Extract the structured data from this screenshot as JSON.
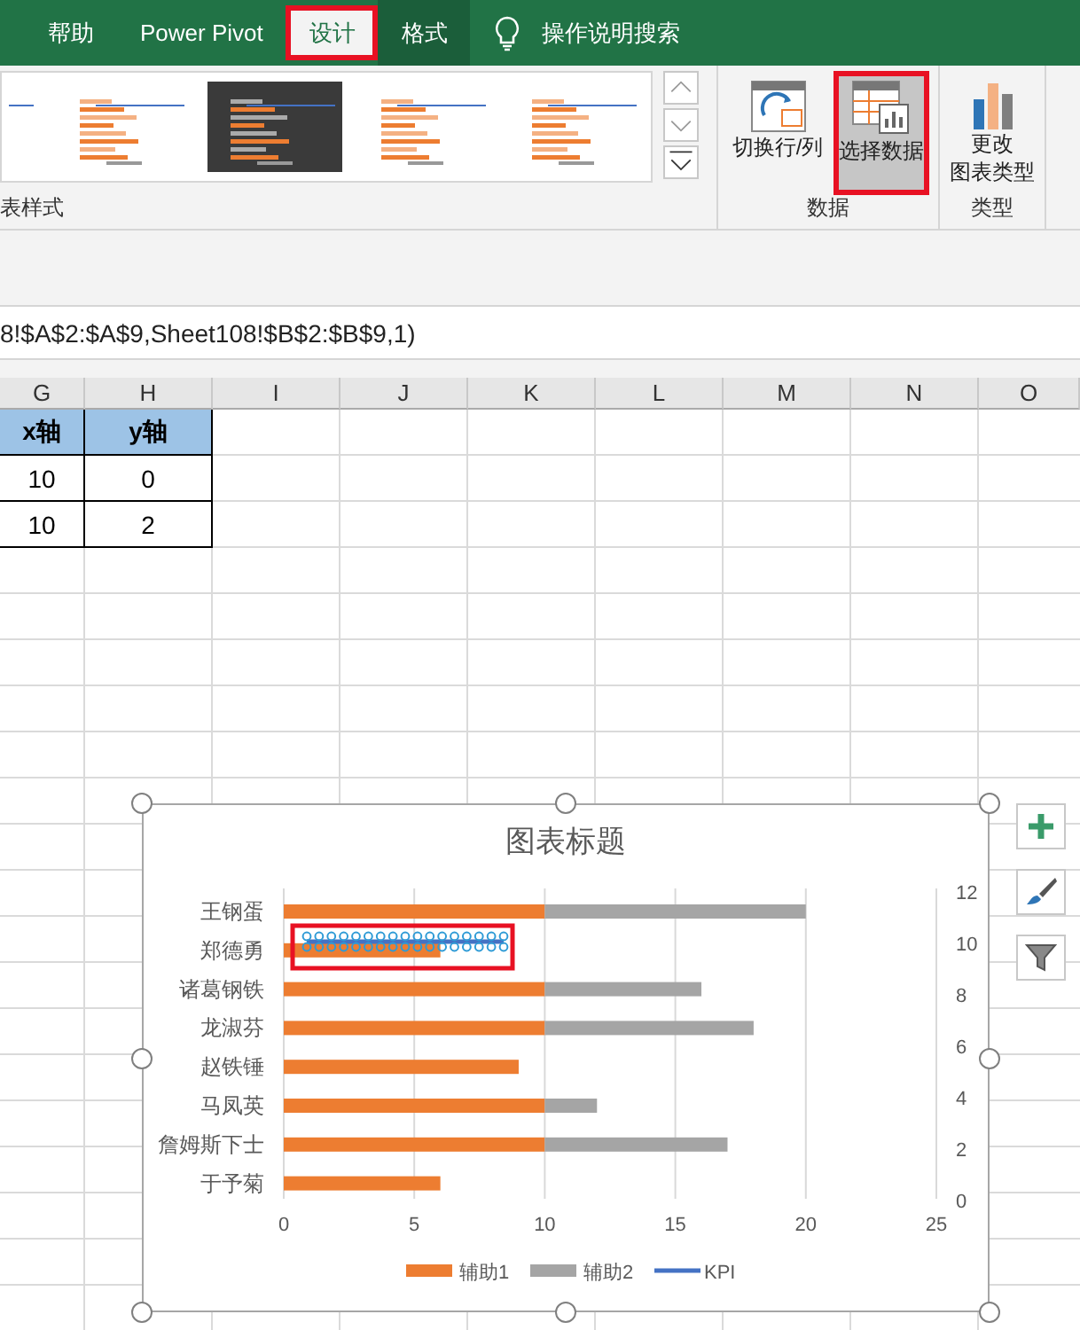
{
  "ribbon_tabs": [
    {
      "label": "帮助",
      "selected": false,
      "highlighted": false,
      "kind": "normal"
    },
    {
      "label": "Power Pivot",
      "selected": false,
      "highlighted": false,
      "kind": "normal"
    },
    {
      "label": "设计",
      "selected": true,
      "highlighted": true,
      "kind": "normal"
    },
    {
      "label": "格式",
      "selected": false,
      "highlighted": false,
      "kind": "contextual"
    }
  ],
  "tell_me": {
    "label": "操作说明搜索"
  },
  "chart_styles": {
    "group_label": "表样式",
    "thumbnails": [
      {
        "kind": "light"
      },
      {
        "kind": "light"
      },
      {
        "kind": "dark"
      },
      {
        "kind": "light"
      },
      {
        "kind": "light"
      }
    ]
  },
  "data_group": {
    "label": "数据",
    "buttons": [
      {
        "label": "切换行/列",
        "selected": false,
        "highlighted": false,
        "kind": "switch"
      },
      {
        "label": "选择数据",
        "selected": true,
        "highlighted": true,
        "kind": "select"
      }
    ]
  },
  "type_group": {
    "label": "类型",
    "buttons": [
      {
        "lines": [
          "更改",
          "图表类型"
        ],
        "kind": "change"
      }
    ]
  },
  "formula": "8!$A$2:$A$9,Sheet108!$B$2:$B$9,1)",
  "columns": [
    "G",
    "H",
    "I",
    "J",
    "K",
    "L",
    "M",
    "N",
    "O"
  ],
  "table": {
    "header": [
      "x轴",
      "y轴"
    ],
    "rows": [
      [
        "10",
        "0"
      ],
      [
        "10",
        "2"
      ]
    ]
  },
  "chart": {
    "chart_data": {
      "type": "bar",
      "orientation": "horizontal",
      "stacked": true,
      "grid": true,
      "legend": true,
      "title": "图表标题",
      "categories": [
        "王钢蛋",
        "郑德勇",
        "诸葛钢铁",
        "龙淑芬",
        "赵铁锤",
        "马凤英",
        "詹姆斯下士",
        "于予菊"
      ],
      "series": [
        {
          "name": "辅助1",
          "color": "#ed7d31",
          "values": [
            10,
            6,
            10,
            10,
            9,
            10,
            10,
            6
          ]
        },
        {
          "name": "辅助2",
          "color": "#a5a5a5",
          "values": [
            10,
            0,
            6,
            8,
            0,
            2,
            7,
            0
          ]
        }
      ],
      "xlim": [
        0,
        25
      ],
      "xticks": [
        0,
        5,
        10,
        15,
        20,
        25
      ]
    },
    "secondary_ticks": [
      "12",
      "10",
      "8",
      "6",
      "4",
      "2",
      "0"
    ],
    "kpi": {
      "name": "KPI",
      "color": "#4472c4",
      "selected": true,
      "highlighted": true
    }
  }
}
